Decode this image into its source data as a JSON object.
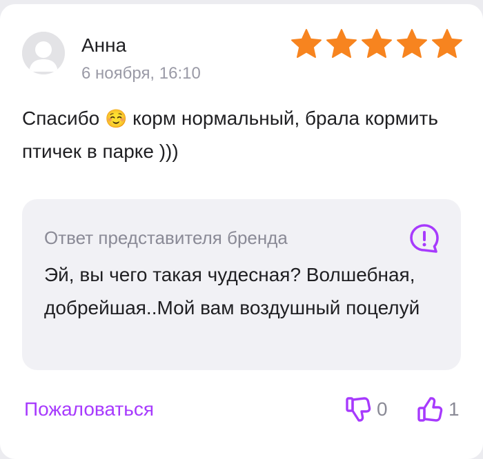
{
  "review": {
    "author": "Анна",
    "date": "6 ноября, 16:10",
    "rating": 5,
    "rating_max": 5,
    "star_color": "#f7841f",
    "text_before_emoji": "Спасибо ",
    "emoji": "☺️",
    "text_after_emoji": " корм нормальный, брала кормить птичек в парке )))"
  },
  "brand_answer": {
    "title": "Ответ представителя бренда",
    "icon": "exclamation-speech-bubble-icon",
    "text": "Эй, вы чего такая чудесная? Волшебная, добрейшая..Мой вам воздушный поцелуй"
  },
  "actions": {
    "complain_label": "Пожаловаться",
    "dislike_count": "0",
    "like_count": "1",
    "accent_color": "#a73afd"
  }
}
